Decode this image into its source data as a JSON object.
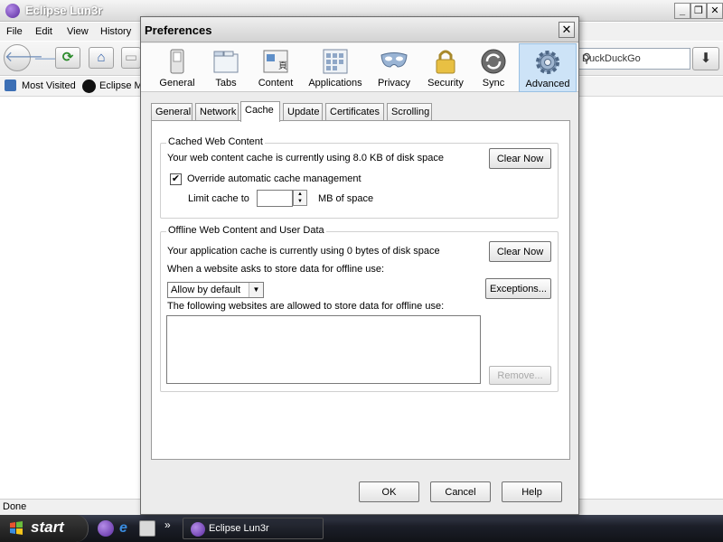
{
  "browser": {
    "title": "Eclipse Lun3r",
    "menus": [
      "File",
      "Edit",
      "View",
      "History"
    ],
    "search_placeholder": "DuckDuckGo",
    "bookmarks": [
      "Most Visited",
      "Eclipse M"
    ],
    "status": "Done"
  },
  "taskbar": {
    "start_label": "start",
    "task_label": "Eclipse Lun3r",
    "overflow": "»"
  },
  "dialog": {
    "title": "Preferences",
    "close": "✕",
    "panes": [
      {
        "label": "General",
        "icon": "general-switch-icon"
      },
      {
        "label": "Tabs",
        "icon": "tabs-icon"
      },
      {
        "label": "Content",
        "icon": "content-icon"
      },
      {
        "label": "Applications",
        "icon": "applications-icon"
      },
      {
        "label": "Privacy",
        "icon": "privacy-mask-icon"
      },
      {
        "label": "Security",
        "icon": "security-lock-icon"
      },
      {
        "label": "Sync",
        "icon": "sync-icon"
      },
      {
        "label": "Advanced",
        "icon": "advanced-gear-icon"
      }
    ],
    "selected_pane": "Advanced",
    "tabs": [
      "General",
      "Network",
      "Cache",
      "Update",
      "Certificates",
      "Scrolling"
    ],
    "active_tab": "Cache",
    "cached": {
      "title": "Cached Web Content",
      "usage": "Your web content cache is currently using 8.0 KB of disk space",
      "clear": "Clear Now",
      "override_label": "Override automatic cache management",
      "override_checked": "✔",
      "limit_label": "Limit cache to",
      "limit_value": "",
      "unit": "MB of space"
    },
    "offline": {
      "title": "Offline Web Content and User Data",
      "usage": "Your application cache is currently using 0 bytes of disk space",
      "clear": "Clear Now",
      "ask_label": "When a website asks to store data for offline use:",
      "select_value": "Allow by default",
      "exceptions": "Exceptions...",
      "allowed_label": "The following websites are allowed to store data for offline use:",
      "remove": "Remove..."
    },
    "buttons": {
      "ok": "OK",
      "cancel": "Cancel",
      "help": "Help"
    }
  },
  "colors": {
    "selected_pane_bg": "#cde3f7",
    "app_purple": "#7b45c4",
    "taskbar": "#1c1f29"
  }
}
